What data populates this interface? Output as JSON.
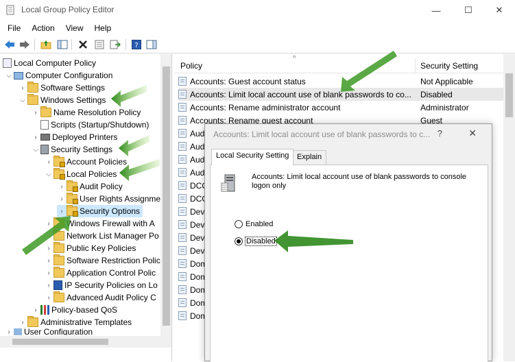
{
  "window": {
    "title": "Local Group Policy Editor",
    "minimize_glyph": "—",
    "maximize_glyph": "☐",
    "close_glyph": "✕"
  },
  "menu": [
    "File",
    "Action",
    "View",
    "Help"
  ],
  "toolbar": {
    "icons": [
      "back-icon",
      "forward-icon",
      "up-folder-icon",
      "show-hide-tree-icon",
      "delete-icon",
      "properties-icon",
      "export-list-icon",
      "help-icon",
      "show-hide-action-pane-icon"
    ]
  },
  "tree": {
    "items": [
      {
        "label": "Local Computer Policy"
      },
      {
        "label": "Computer Configuration"
      },
      {
        "label": "Software Settings"
      },
      {
        "label": "Windows Settings"
      },
      {
        "label": "Name Resolution Policy"
      },
      {
        "label": "Scripts (Startup/Shutdown)"
      },
      {
        "label": "Deployed Printers"
      },
      {
        "label": "Security Settings"
      },
      {
        "label": "Account Policies"
      },
      {
        "label": "Local Policies"
      },
      {
        "label": "Audit Policy"
      },
      {
        "label": "User Rights Assignme"
      },
      {
        "label": "Security Options"
      },
      {
        "label": "Windows Firewall with A"
      },
      {
        "label": "Network List Manager Po"
      },
      {
        "label": "Public Key Policies"
      },
      {
        "label": "Software Restriction Polic"
      },
      {
        "label": "Application Control Polic"
      },
      {
        "label": "IP Security Policies on Lo"
      },
      {
        "label": "Advanced Audit Policy C"
      },
      {
        "label": "Policy-based QoS"
      },
      {
        "label": "Administrative Templates"
      },
      {
        "label": "User Configuration"
      }
    ]
  },
  "list": {
    "col_policy": "Policy",
    "col_setting": "Security Setting",
    "rows": [
      {
        "policy": "Accounts: Guest account status",
        "setting": "Not Applicable"
      },
      {
        "policy": "Accounts: Limit local account use of blank passwords to co...",
        "setting": "Disabled"
      },
      {
        "policy": "Accounts: Rename administrator account",
        "setting": "Administrator"
      },
      {
        "policy": "Accounts: Rename guest account",
        "setting": "Guest"
      },
      {
        "policy": "Aud",
        "setting": ""
      },
      {
        "policy": "Aud",
        "setting": ""
      },
      {
        "policy": "Aud",
        "setting": ""
      },
      {
        "policy": "Aud",
        "setting": ""
      },
      {
        "policy": "DCO",
        "setting": ""
      },
      {
        "policy": "DCO",
        "setting": ""
      },
      {
        "policy": "Dev",
        "setting": ""
      },
      {
        "policy": "Dev",
        "setting": ""
      },
      {
        "policy": "Dev",
        "setting": ""
      },
      {
        "policy": "Dev",
        "setting": ""
      },
      {
        "policy": "Dom",
        "setting": ""
      },
      {
        "policy": "Dom",
        "setting": ""
      },
      {
        "policy": "Dom",
        "setting": ""
      },
      {
        "policy": "Dom",
        "setting": ""
      },
      {
        "policy": "Dom",
        "setting": ""
      }
    ]
  },
  "dialog": {
    "title": "Accounts: Limit local account use of blank passwords to c...",
    "help_glyph": "?",
    "close_glyph": "✕",
    "tab_local": "Local Security Setting",
    "tab_explain": "Explain",
    "description": "Accounts: Limit local account use of blank passwords to console logon only",
    "option_enabled": "Enabled",
    "option_disabled": "Disabled",
    "selected": "Disabled"
  },
  "colors": {
    "selection": "#cce8ff",
    "highlight_row": "#e8e8e8",
    "annotation_arrow": "#4aa12a"
  }
}
